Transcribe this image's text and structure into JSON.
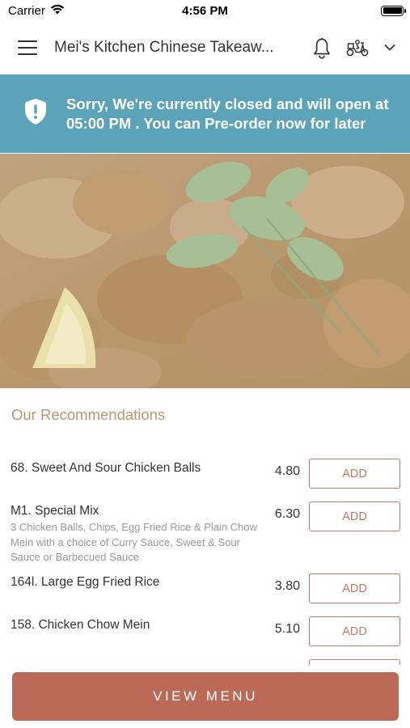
{
  "status_bar": {
    "carrier": "Carrier",
    "time": "4:56 PM"
  },
  "header": {
    "title": "Mei's Kitchen Chinese Takeaw...",
    "icons": [
      "menu-icon",
      "bell-icon",
      "scooter-icon",
      "chevron-down-icon"
    ]
  },
  "banner": {
    "message": "Sorry, We're currently closed and will open at 05:00 PM . You can Pre-order now for later",
    "color": "#5aa3b8"
  },
  "recommendations": {
    "title": "Our Recommendations",
    "add_label": "ADD",
    "items": [
      {
        "name": "68. Sweet And Sour Chicken Balls",
        "description": "",
        "price": "4.80"
      },
      {
        "name": "M1. Special Mix",
        "description": "3 Chicken Balls, Chips, Egg Fried Rice & Plain Chow Mein with a choice of Curry Sauce, Sweet & Sour Sauce or Barbecued Sauce",
        "price": "6.30"
      },
      {
        "name": "164l. Large Egg Fried Rice",
        "description": "",
        "price": "3.80"
      },
      {
        "name": "158. Chicken Chow Mein",
        "description": "",
        "price": "5.10"
      }
    ]
  },
  "footer": {
    "view_menu_label": "VIEW MENU",
    "accent_color": "#bc6a57"
  }
}
